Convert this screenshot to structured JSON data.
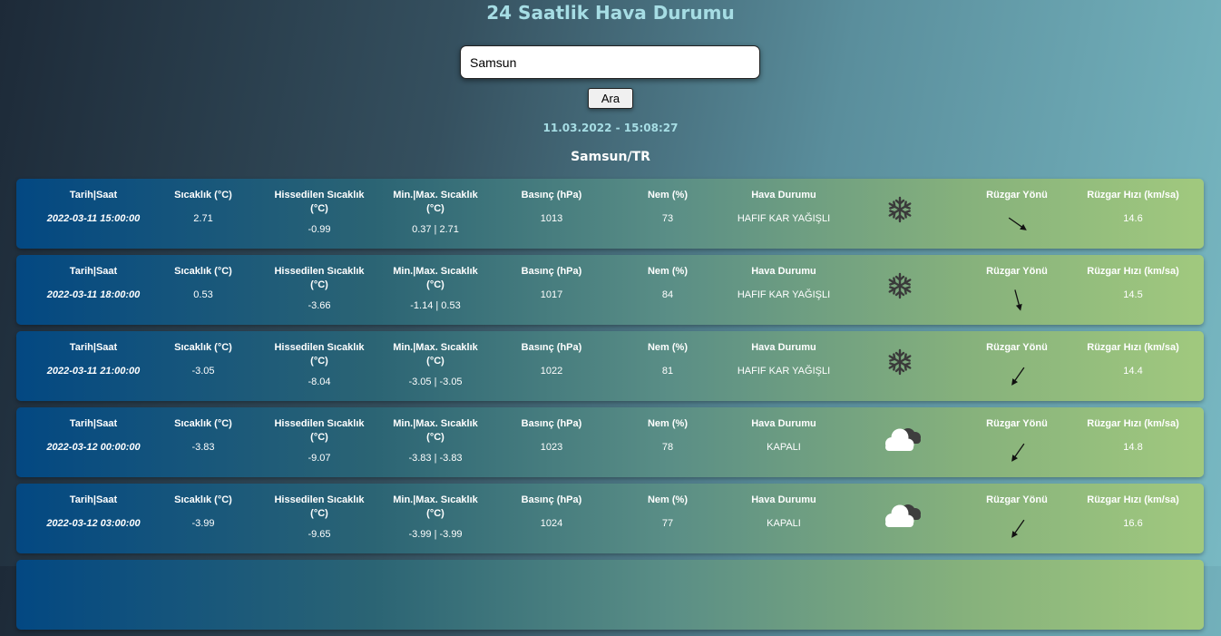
{
  "page": {
    "title": "24 Saatlik Hava Durumu"
  },
  "search": {
    "value": "Samsun",
    "button_label": "Ara"
  },
  "current_datetime": "11.03.2022 - 15:08:27",
  "location": "Samsun/TR",
  "headers": {
    "date": "Tarih|Saat",
    "temp": "Sıcaklık (°C)",
    "feels": "Hissedilen Sıcaklık (°C)",
    "minmax": "Min.|Max. Sıcaklık (°C)",
    "pressure": "Basınç (hPa)",
    "humidity": "Nem (%)",
    "condition": "Hava Durumu",
    "wind_dir": "Rüzgar Yönü",
    "wind_speed": "Rüzgar Hızı (km/sa)"
  },
  "forecasts": [
    {
      "datetime": "2022-03-11 15:00:00",
      "temp": "2.71",
      "feels": "-0.99",
      "minmax": "0.37 | 2.71",
      "pressure": "1013",
      "humidity": "73",
      "condition": "HAFIF KAR YAĞIŞLI",
      "icon": "snowflake-icon",
      "wind_speed": "14.6",
      "wind_deg": 125
    },
    {
      "datetime": "2022-03-11 18:00:00",
      "temp": "0.53",
      "feels": "-3.66",
      "minmax": "-1.14 | 0.53",
      "pressure": "1017",
      "humidity": "84",
      "condition": "HAFIF KAR YAĞIŞLI",
      "icon": "snowflake-icon",
      "wind_speed": "14.5",
      "wind_deg": 165
    },
    {
      "datetime": "2022-03-11 21:00:00",
      "temp": "-3.05",
      "feels": "-8.04",
      "minmax": "-3.05 | -3.05",
      "pressure": "1022",
      "humidity": "81",
      "condition": "HAFIF KAR YAĞIŞLI",
      "icon": "snowflake-icon",
      "wind_speed": "14.4",
      "wind_deg": 215
    },
    {
      "datetime": "2022-03-12 00:00:00",
      "temp": "-3.83",
      "feels": "-9.07",
      "minmax": "-3.83 | -3.83",
      "pressure": "1023",
      "humidity": "78",
      "condition": "KAPALI",
      "icon": "cloud-icon",
      "wind_speed": "14.8",
      "wind_deg": 215
    },
    {
      "datetime": "2022-03-12 03:00:00",
      "temp": "-3.99",
      "feels": "-9.65",
      "minmax": "-3.99 | -3.99",
      "pressure": "1024",
      "humidity": "77",
      "condition": "KAPALI",
      "icon": "cloud-icon",
      "wind_speed": "16.6",
      "wind_deg": 215
    }
  ]
}
